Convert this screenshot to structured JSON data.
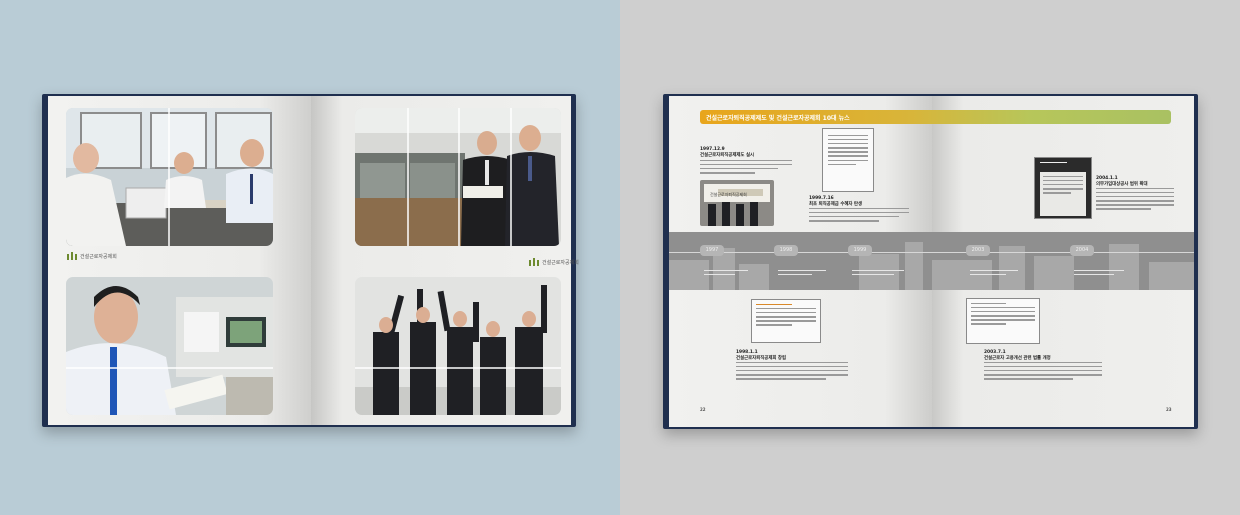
{
  "left_spread": {
    "logo_text_left": "건설근로자공제회",
    "logo_text_right": "건설근로자공제회"
  },
  "right_spread": {
    "title": "건설근로자퇴직공제제도 및 건설근로자공제회 10대 뉴스",
    "timeline_years": [
      "1997",
      "1998",
      "1999",
      "2003",
      "2004"
    ],
    "events": [
      {
        "date": "1997.12.9",
        "heading": "건설근로자퇴직공제제도 실시"
      },
      {
        "date": "1999.7.16",
        "heading": "최초 퇴직공제금 수혜자 탄생"
      },
      {
        "date": "1998.1.1",
        "heading": "건설근로자퇴직공제회 창립"
      },
      {
        "date": "2004.1.1",
        "heading": "의무가입대상공사 범위 확대"
      },
      {
        "date": "2003.7.1",
        "heading": "건설근로자 고용개선 관련 법률 개정"
      }
    ],
    "photo_caption": "건설근로자퇴직공제회",
    "page_numbers": [
      "22",
      "23"
    ]
  },
  "colors": {
    "left_background": "#b9ccd6",
    "right_background": "#cfcfcf",
    "cover_navy": "#1f2f4f",
    "title_bar_start": "#e8a51c",
    "title_bar_end": "#a9c162"
  }
}
